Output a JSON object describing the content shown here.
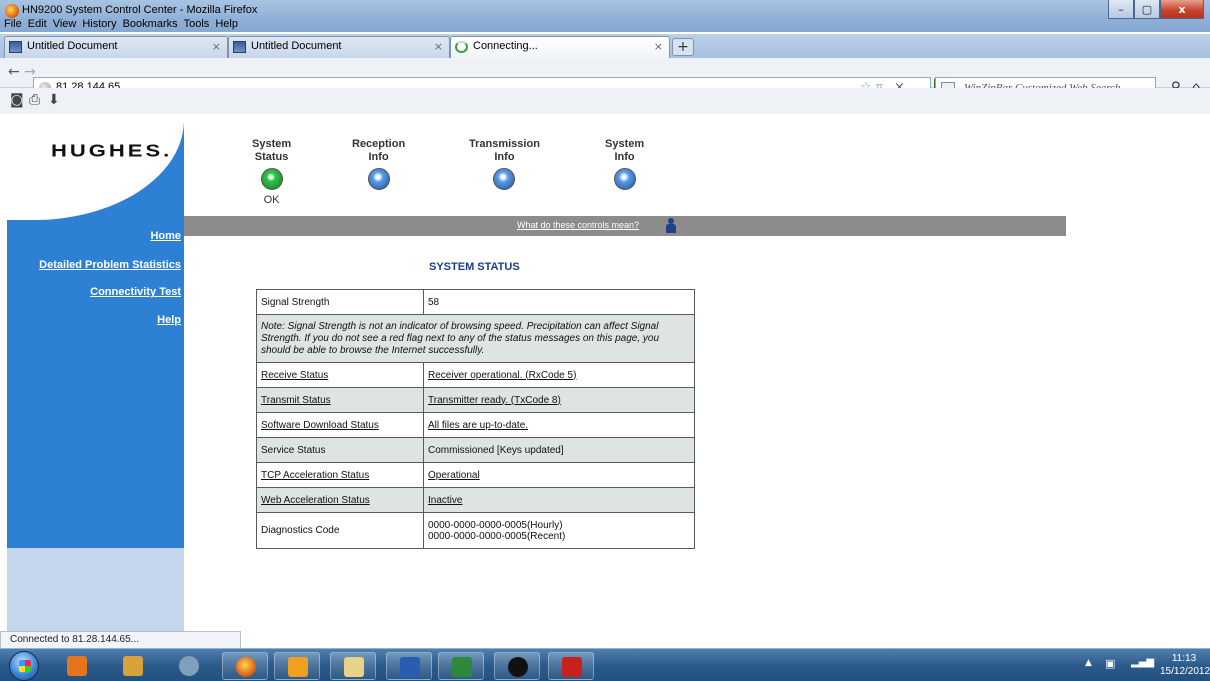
{
  "window": {
    "title": "HN9200 System Control Center - Mozilla Firefox",
    "minimize": "–",
    "maximize": "▢",
    "close": "x"
  },
  "menu": [
    "File",
    "Edit",
    "View",
    "History",
    "Bookmarks",
    "Tools",
    "Help"
  ],
  "tabs": [
    {
      "label": "Untitled Document",
      "close": "×"
    },
    {
      "label": "Untitled Document",
      "close": "×"
    },
    {
      "label": "Connecting...",
      "close": "×"
    }
  ],
  "newtab": "+",
  "nav": {
    "back": "←",
    "forward": "→",
    "url": "81.28.144.65",
    "bookmark_star": "☆",
    "dropdown": "▿",
    "stop": "×",
    "search_placeholder": "WinZipBar Customized Web Search",
    "search_go": "⚲",
    "home": "⌂"
  },
  "toolbar": {
    "icons": [
      "◙",
      "⎙",
      "⬇"
    ]
  },
  "page": {
    "logo": "HUGHES.",
    "status_icons": [
      {
        "label1": "System",
        "label2": "Status",
        "state": "OK",
        "color": "#33c54a"
      },
      {
        "label1": "Reception",
        "label2": "Info",
        "state": "",
        "color": "#5b9ce6"
      },
      {
        "label1": "Transmission",
        "label2": "Info",
        "state": "",
        "color": "#5b9ce6"
      },
      {
        "label1": "System",
        "label2": "Info",
        "state": "",
        "color": "#5b9ce6"
      }
    ],
    "help_link": "What do these controls mean?",
    "sidebar_links": [
      "Home",
      "Detailed Problem Statistics",
      "Connectivity Test",
      "Help"
    ],
    "section_title": "SYSTEM STATUS",
    "table": {
      "signal_label": "Signal Strength",
      "signal_value": "58",
      "note": "Note: Signal Strength is not an indicator of browsing speed. Precipitation can affect Signal Strength. If you do not see a red flag next to any of the status messages on this page, you should be able to browse the Internet successfully.",
      "rows": [
        {
          "label": "Receive Status",
          "value": "Receiver operational. (RxCode 5)"
        },
        {
          "label": "Transmit Status",
          "value": "Transmitter ready. (TxCode 8)"
        },
        {
          "label": "Software Download Status",
          "value": "All files are up-to-date."
        },
        {
          "label": "Service Status",
          "value": "Commissioned [Keys updated]"
        },
        {
          "label": "TCP Acceleration Status",
          "value": "Operational"
        },
        {
          "label": "Web Acceleration Status",
          "value": "Inactive"
        }
      ],
      "diag_label": "Diagnostics Code",
      "diag_value1": "0000-0000-0000-0005(Hourly)",
      "diag_value2": "0000-0000-0000-0005(Recent)"
    }
  },
  "statusbar": "Connected to 81.28.144.65...",
  "tray": {
    "arrow": "▲",
    "time": "11:13",
    "date": "15/12/2012"
  },
  "colors": {
    "sidebar_blue": "#2e80d5",
    "title_blue": "#1a3c8f",
    "ok_green": "#33c54a",
    "help_bar": "#8c8c8c",
    "row_shade": "#dee3e3"
  }
}
